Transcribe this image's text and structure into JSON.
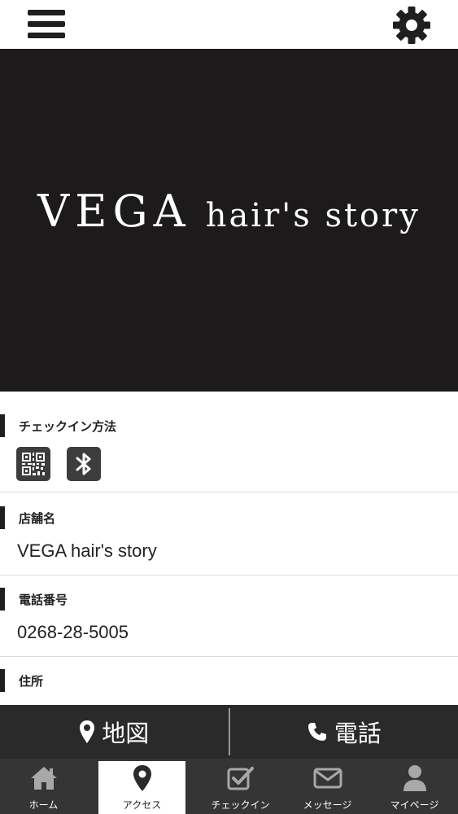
{
  "header": {
    "menu_icon": "hamburger-menu-icon",
    "settings_icon": "gear-icon"
  },
  "hero": {
    "logo_main": "VEGA",
    "logo_sub": "hair's story",
    "background": "#1c1a1b"
  },
  "checkin": {
    "title": "チェックイン方法",
    "methods": [
      "qr-code-icon",
      "bluetooth-icon"
    ]
  },
  "shop": {
    "title": "店舗名",
    "value": "VEGA hair's story"
  },
  "phone": {
    "title": "電話番号",
    "value": "0268-28-5005"
  },
  "address": {
    "title": "住所"
  },
  "actions": {
    "map_label": "地図",
    "call_label": "電話"
  },
  "tabs": [
    {
      "label": "ホーム",
      "icon": "home-icon",
      "active": false
    },
    {
      "label": "アクセス",
      "icon": "map-pin-icon",
      "active": true
    },
    {
      "label": "チェックイン",
      "icon": "checkbox-icon",
      "active": false
    },
    {
      "label": "メッセージ",
      "icon": "mail-icon",
      "active": false
    },
    {
      "label": "マイページ",
      "icon": "user-icon",
      "active": false
    }
  ],
  "colors": {
    "dark": "#1f1f1f",
    "action_bar": "#2a2a2a",
    "tab_bar": "#353535",
    "tab_icon": "#a8a8a8"
  }
}
